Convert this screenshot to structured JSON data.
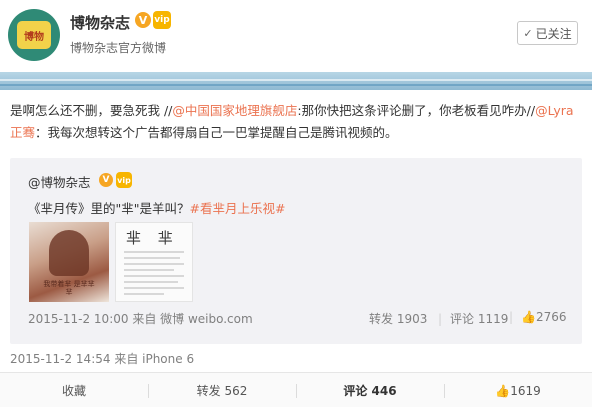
{
  "header": {
    "avatar_text": "博物",
    "name": "博物杂志",
    "v_badge": "V",
    "vip_badge": "vip",
    "subtitle": "博物杂志官方微博",
    "follow_check": "✓",
    "follow_label": "已关注"
  },
  "post": {
    "text_1": "是啊怎么还不删，要急死我 //",
    "mention_1": "@中国国家地理旗舰店",
    "text_2": ":那你快把这条评论删了，你老板看见咋办//",
    "mention_2": "@Lyra正骞",
    "text_3": "：我每次想转这个广告都得扇自己一巴掌提醒自己是腾讯视频的。",
    "meta": "2015-11-2 14:54 来自 iPhone 6"
  },
  "repost": {
    "name": "@博物杂志",
    "v_badge": "V",
    "vip_badge": "vip",
    "text": "《芈月传》里的\"芈\"是羊叫？",
    "hashtag": "#看芈月上乐视#",
    "thumb1_caption": "我带着芈 是芈芈芈",
    "thumb2_chars": "芈 芈",
    "meta": "2015-11-2 10:00 来自 微博 weibo.com",
    "repost_count": "转发 1903",
    "comment_count": "评论 1119",
    "like_icon": "👍",
    "like_count": "2766"
  },
  "actions": {
    "collect": "收藏",
    "repost": "转发 562",
    "comment": "评论 446",
    "like_icon": "👍",
    "like": "1619"
  },
  "colors": {
    "link": "#eb7350",
    "meta_gray": "#808080",
    "repost_bg": "#f2f2f5"
  }
}
